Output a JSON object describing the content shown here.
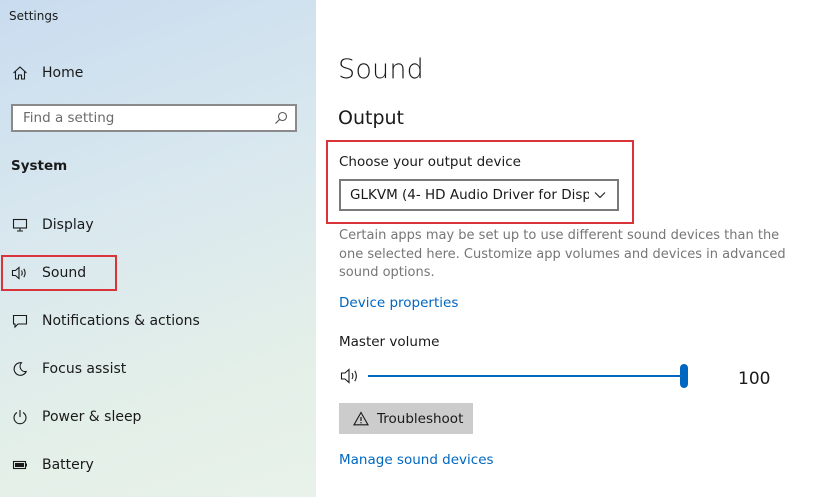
{
  "window": {
    "title": "Settings"
  },
  "sidebar": {
    "home_label": "Home",
    "search_placeholder": "Find a setting",
    "section_label": "System",
    "items": [
      {
        "label": "Display",
        "icon": "monitor-icon"
      },
      {
        "label": "Sound",
        "icon": "speaker-icon",
        "selected": true
      },
      {
        "label": "Notifications & actions",
        "icon": "notification-icon"
      },
      {
        "label": "Focus assist",
        "icon": "moon-icon"
      },
      {
        "label": "Power & sleep",
        "icon": "power-icon"
      },
      {
        "label": "Battery",
        "icon": "battery-icon"
      }
    ]
  },
  "main": {
    "title": "Sound",
    "output": {
      "header": "Output",
      "device_label": "Choose your output device",
      "device_value": "GLKVM (4- HD Audio Driver for Disp...",
      "description": "Certain apps may be set up to use different sound devices than the one selected here. Customize app volumes and devices in advanced sound options.",
      "device_properties_link": "Device properties",
      "master_volume_label": "Master volume",
      "volume_value": "100",
      "volume_level": 100,
      "troubleshoot_label": "Troubleshoot",
      "manage_devices_link": "Manage sound devices"
    }
  },
  "colors": {
    "accent": "#0067c0",
    "highlight_box": "#d9343a"
  }
}
